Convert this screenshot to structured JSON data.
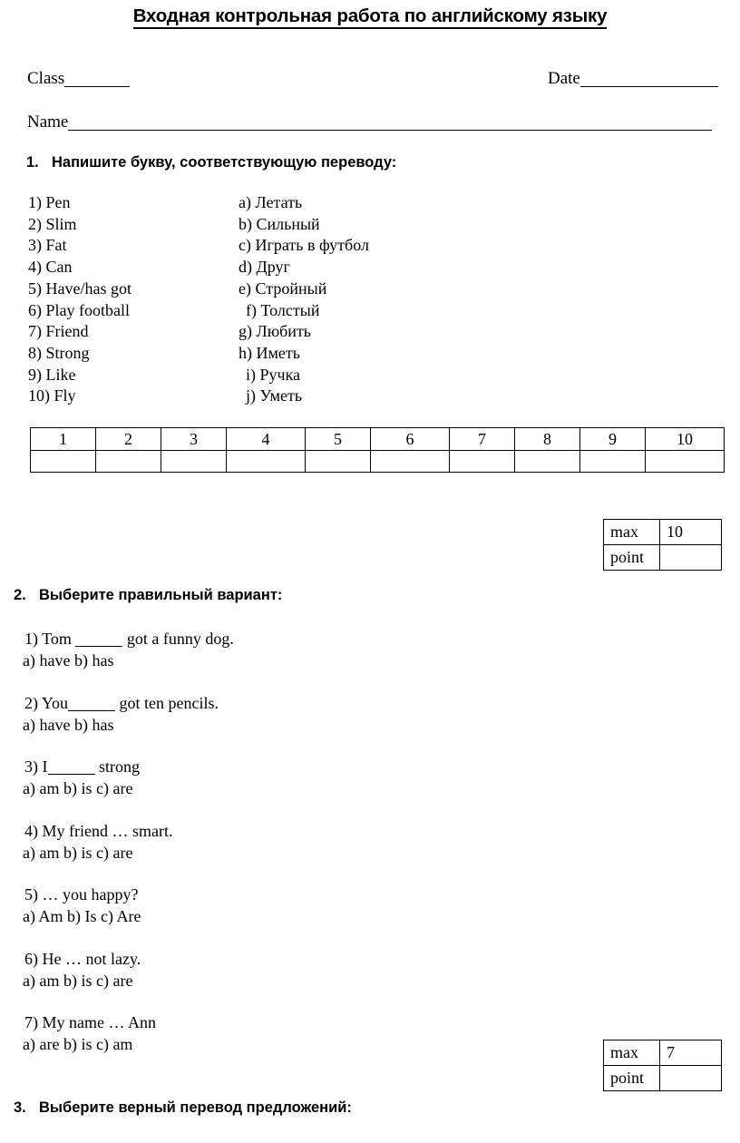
{
  "document": {
    "title": "Входная контрольная работа по английскому языку"
  },
  "identity": {
    "class_label": "Class",
    "date_label": "Date",
    "name_label": "Name"
  },
  "exercise1": {
    "number": "1.",
    "heading": "Напишите букву, соответствующую переводу:",
    "left_items": [
      "1) Pen",
      "2) Slim",
      "3) Fat",
      "4) Can",
      "5) Have/has got",
      "6) Play football",
      "7) Friend",
      "8) Strong",
      "9) Like",
      "10) Fly"
    ],
    "right_items": [
      "a) Летать",
      "b) Сильный",
      "c) Играть в футбол",
      "d) Друг",
      "e) Стройный",
      "f) Толстый",
      "g) Любить",
      "h) Иметь",
      "i) Ручка",
      "j) Уметь"
    ],
    "answer_grid_headers": [
      "1",
      "2",
      "3",
      "4",
      "5",
      "6",
      "7",
      "8",
      "9",
      "10"
    ],
    "answer_grid_values": [
      "",
      "",
      "",
      "",
      "",
      "",
      "",
      "",
      "",
      ""
    ],
    "score": {
      "max_label": "max",
      "max_value": "10",
      "point_label": "point",
      "point_value": ""
    }
  },
  "exercise2": {
    "number": "2.",
    "heading": "Выберите правильный вариант:",
    "items": [
      {
        "question_before": "1) Tom ",
        "question_after": " got a funny dog.",
        "blank": true,
        "answers": "a) have  b) has"
      },
      {
        "question_before": "2) You",
        "question_after": " got ten pencils.",
        "blank": true,
        "answers": "a) have   b) has"
      },
      {
        "question_before": "3) I",
        "question_after": " strong",
        "blank": true,
        "answers": "a) am   b) is  c) are"
      },
      {
        "question_before": "4) My friend … smart.",
        "question_after": "",
        "blank": false,
        "answers": "a) am  b) is  c) are"
      },
      {
        "question_before": "5) … you happy?",
        "question_after": "",
        "blank": false,
        "answers": "a) Am b) Is  c) Are"
      },
      {
        "question_before": "6) He … not lazy.",
        "question_after": "",
        "blank": false,
        "answers": "a) am   b) is  c) are"
      },
      {
        "question_before": "7) My name … Ann",
        "question_after": "",
        "blank": false,
        "answers": "a) are   b) is   c) am"
      }
    ],
    "score": {
      "max_label": "max",
      "max_value": "7",
      "point_label": "point",
      "point_value": ""
    }
  },
  "exercise3": {
    "number": "3.",
    "heading": "Выберите верный перевод предложений:"
  }
}
